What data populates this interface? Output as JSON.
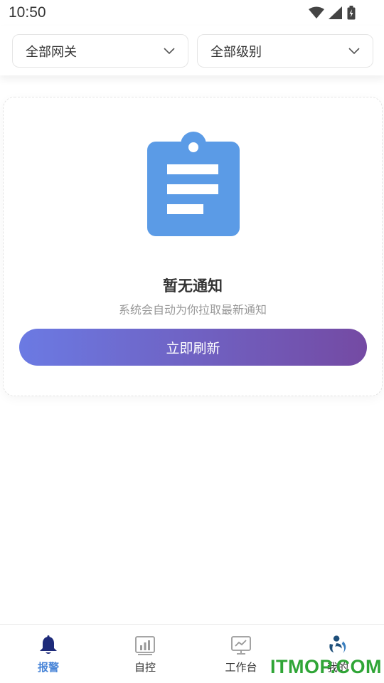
{
  "status_bar": {
    "time": "10:50"
  },
  "filters": {
    "gateway": {
      "label": "全部网关"
    },
    "level": {
      "label": "全部级别"
    }
  },
  "empty_state": {
    "icon": "clipboard-icon",
    "title": "暂无通知",
    "subtitle": "系统会自动为你拉取最新通知",
    "refresh_label": "立即刷新"
  },
  "nav": {
    "items": [
      {
        "label": "报警",
        "icon": "bell-icon",
        "active": true
      },
      {
        "label": "自控",
        "icon": "bar-chart-icon",
        "active": false
      },
      {
        "label": "工作台",
        "icon": "monitor-icon",
        "active": false
      },
      {
        "label": "我的",
        "icon": "profile-icon",
        "active": false
      }
    ]
  },
  "colors": {
    "accent": "#4a86d8",
    "clipboard": "#5b9be6",
    "button_gradient_start": "#6b7ae3",
    "button_gradient_end": "#744aa3"
  },
  "watermark": {
    "text": "ITMOP.COM"
  }
}
